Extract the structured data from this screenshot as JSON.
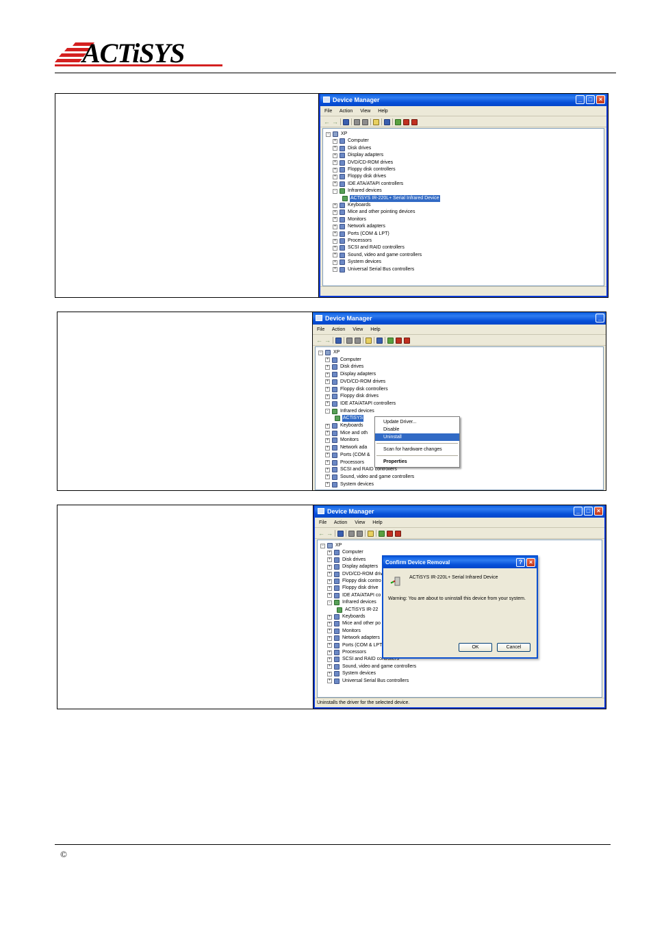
{
  "header": {
    "brand_logo_text": "ACTiSYS",
    "copyright_symbol": "©"
  },
  "window": {
    "title": "Device Manager",
    "menu": [
      "File",
      "Action",
      "View",
      "Help"
    ],
    "root": "XP"
  },
  "tree": [
    {
      "label": "Computer",
      "expander": "+"
    },
    {
      "label": "Disk drives",
      "expander": "+"
    },
    {
      "label": "Display adapters",
      "expander": "+"
    },
    {
      "label": "DVD/CD-ROM drives",
      "expander": "+"
    },
    {
      "label": "Floppy disk controllers",
      "expander": "+"
    },
    {
      "label": "Floppy disk drives",
      "expander": "+"
    },
    {
      "label": "IDE ATA/ATAPI controllers",
      "expander": "+"
    },
    {
      "label": "Infrared devices",
      "expander": "-"
    },
    {
      "label": "ACTiSYS IR-220L+ Serial Infrared Device",
      "child": true
    },
    {
      "label": "Keyboards",
      "expander": "+"
    },
    {
      "label": "Mice and other pointing devices",
      "expander": "+"
    },
    {
      "label": "Monitors",
      "expander": "+"
    },
    {
      "label": "Network adapters",
      "expander": "+"
    },
    {
      "label": "Ports (COM & LPT)",
      "expander": "+"
    },
    {
      "label": "Processors",
      "expander": "+"
    },
    {
      "label": "SCSI and RAID controllers",
      "expander": "+"
    },
    {
      "label": "Sound, video and game controllers",
      "expander": "+"
    },
    {
      "label": "System devices",
      "expander": "+"
    },
    {
      "label": "Universal Serial Bus controllers",
      "expander": "+"
    }
  ],
  "step2": {
    "selected_short": "ACTiSYS",
    "truncated": {
      "mice": "Mice and oth",
      "network": "Network ada",
      "ports": "Ports (COM &"
    },
    "context_menu": [
      "Update Driver...",
      "Disable",
      "Uninstall",
      "Scan for hardware changes",
      "Properties"
    ]
  },
  "step3": {
    "truncated": {
      "dvd": "DVD/CD-ROM driv",
      "floppy_ctrl": "Floppy disk contro",
      "floppy_drv": "Floppy disk drive",
      "ide": "IDE ATA/ATAPI co",
      "actisys": "ACTiSYS IR-22",
      "mice": "Mice and other po",
      "network": "Network adapters",
      "ports": "Ports (COM & LPT"
    },
    "status": "Uninstalls the driver for the selected device.",
    "dialog": {
      "title": "Confirm Device Removal",
      "device": "ACTiSYS IR-220L+ Serial Infrared Device",
      "warning": "Warning: You are about to uninstall this device from your system.",
      "ok": "OK",
      "cancel": "Cancel"
    }
  }
}
